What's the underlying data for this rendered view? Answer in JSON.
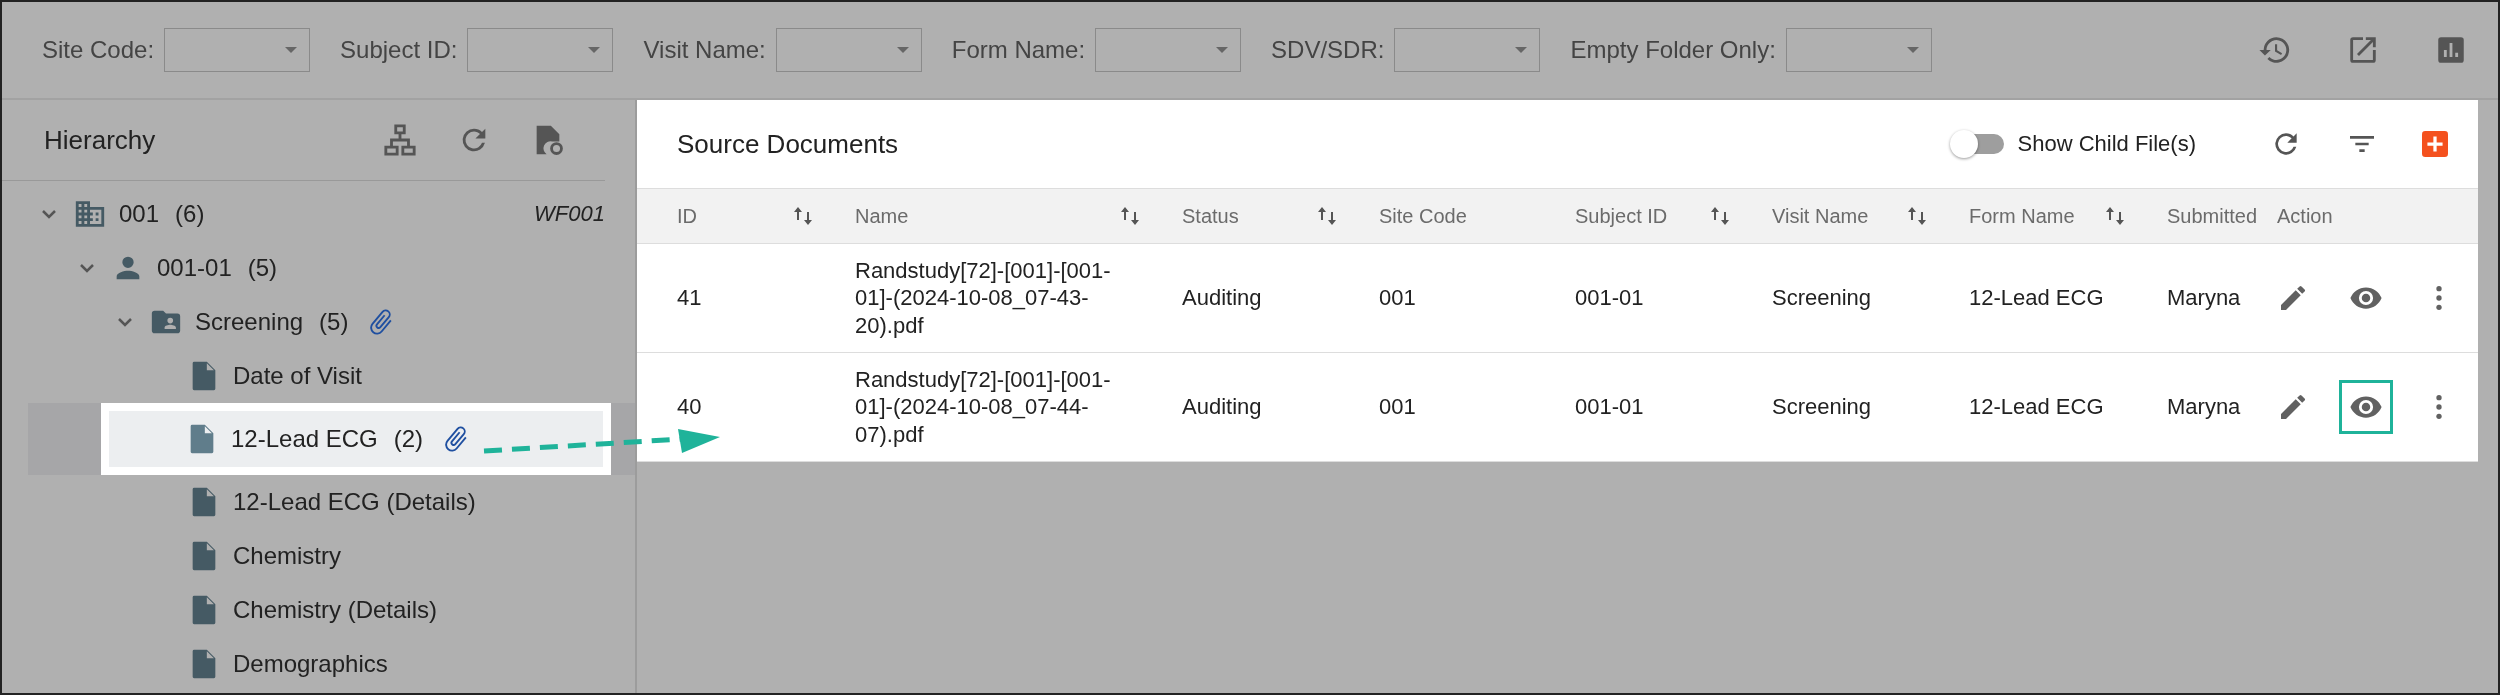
{
  "filters": [
    {
      "label": "Site Code:"
    },
    {
      "label": "Subject ID:"
    },
    {
      "label": "Visit Name:"
    },
    {
      "label": "Form Name:"
    },
    {
      "label": "SDV/SDR:"
    },
    {
      "label": "Empty Folder Only:"
    }
  ],
  "hierarchy": {
    "title": "Hierarchy",
    "tree": [
      {
        "kind": "site",
        "label": "001",
        "count": "(6)",
        "tag": "WF001",
        "expanded": true,
        "attachment": false,
        "selected": false,
        "children": [
          {
            "kind": "subject",
            "label": "001-01",
            "count": "(5)",
            "expanded": true,
            "attachment": false,
            "selected": false,
            "children": [
              {
                "kind": "visit",
                "label": "Screening",
                "count": "(5)",
                "expanded": true,
                "attachment": true,
                "selected": false,
                "children": [
                  {
                    "kind": "form",
                    "label": "Date of Visit",
                    "attachment": false,
                    "selected": false
                  },
                  {
                    "kind": "form",
                    "label": "12-Lead ECG",
                    "count": "(2)",
                    "attachment": true,
                    "selected": true
                  },
                  {
                    "kind": "form",
                    "label": "12-Lead ECG (Details)",
                    "attachment": false,
                    "selected": false
                  },
                  {
                    "kind": "form",
                    "label": "Chemistry",
                    "attachment": false,
                    "selected": false
                  },
                  {
                    "kind": "form",
                    "label": "Chemistry (Details)",
                    "attachment": false,
                    "selected": false
                  },
                  {
                    "kind": "form",
                    "label": "Demographics",
                    "attachment": false,
                    "selected": false
                  }
                ]
              }
            ]
          }
        ]
      }
    ]
  },
  "source_documents": {
    "title": "Source Documents",
    "show_child_files": {
      "label": "Show Child File(s)",
      "on": false
    },
    "columns": [
      {
        "label": "ID",
        "sortable": true
      },
      {
        "label": "Name",
        "sortable": true
      },
      {
        "label": "Status",
        "sortable": true
      },
      {
        "label": "Site Code",
        "sortable": false
      },
      {
        "label": "Subject ID",
        "sortable": true
      },
      {
        "label": "Visit Name",
        "sortable": true
      },
      {
        "label": "Form Name",
        "sortable": true
      },
      {
        "label": "Submitted",
        "sortable": false
      },
      {
        "label": "Action",
        "sortable": false
      }
    ],
    "rows": [
      {
        "cells": [
          "41",
          "Randstudy[72]-[001]-[001-01]-(2024-10-08_07-43-20).pdf",
          "Auditing",
          "001",
          "001-01",
          "Screening",
          "12-Lead ECG",
          "Maryna"
        ],
        "view_highlighted": false
      },
      {
        "cells": [
          "40",
          "Randstudy[72]-[001]-[001-01]-(2024-10-08_07-44-07).pdf",
          "Auditing",
          "001",
          "001-01",
          "Screening",
          "12-Lead ECG",
          "Maryna"
        ],
        "view_highlighted": true
      }
    ]
  }
}
